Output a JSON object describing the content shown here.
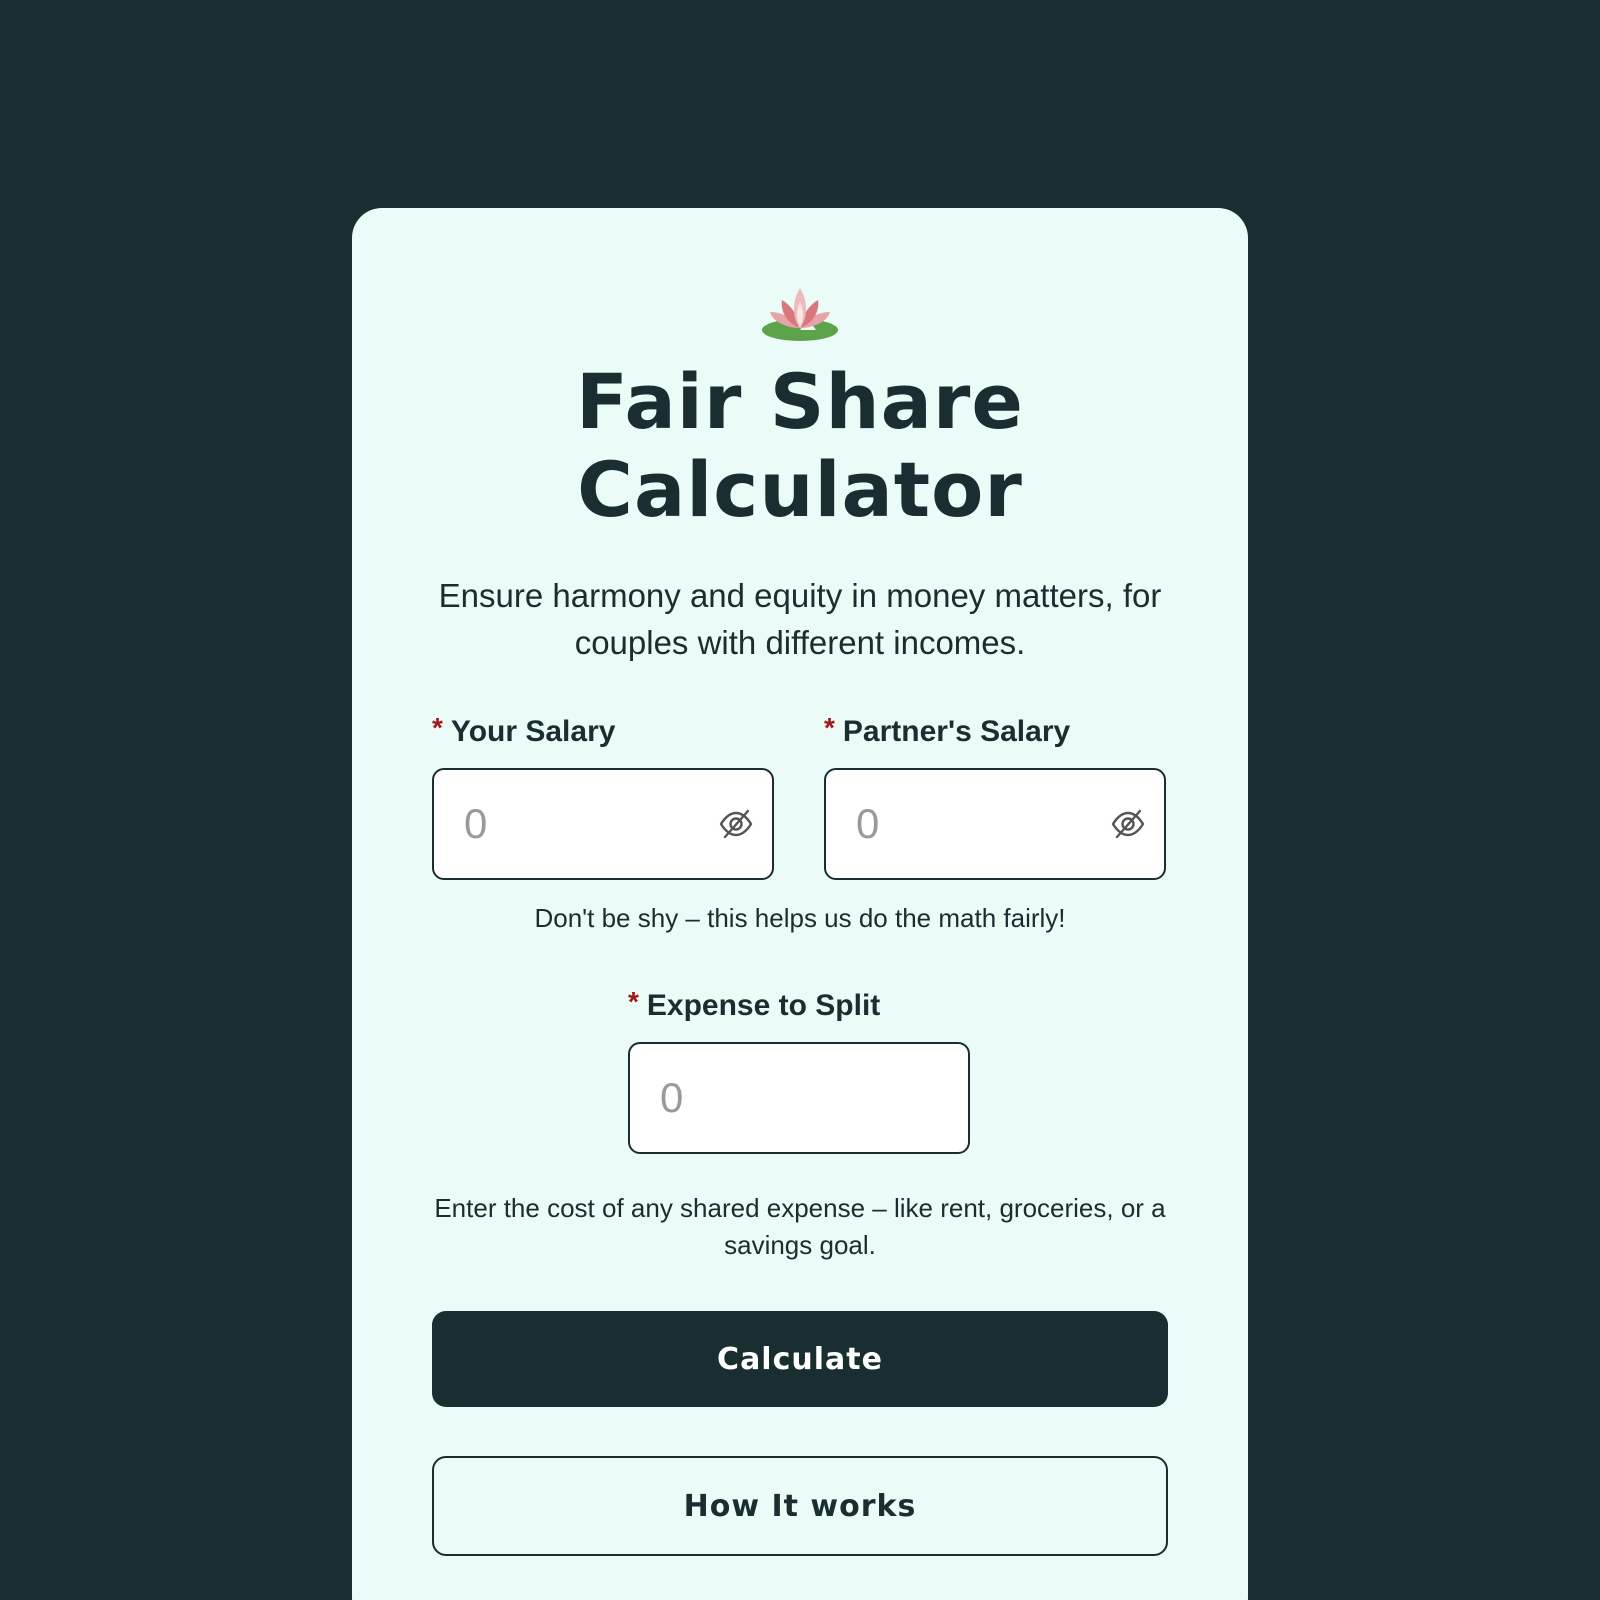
{
  "header": {
    "logo_icon": "lotus-icon",
    "title_line1": "Fair Share",
    "title_line2": "Calculator",
    "subtitle": "Ensure harmony and equity in money matters, for couples with different incomes."
  },
  "form": {
    "required_marker": "*",
    "your_salary": {
      "label": "Your Salary",
      "placeholder": "0",
      "value": "",
      "toggle_icon": "eye-off-icon"
    },
    "partner_salary": {
      "label": "Partner's Salary",
      "placeholder": "0",
      "value": "",
      "toggle_icon": "eye-off-icon"
    },
    "salary_hint": "Don't be shy – this helps us do the math fairly!",
    "expense": {
      "label": "Expense to Split",
      "placeholder": "0",
      "value": ""
    },
    "expense_hint": "Enter the cost of any shared expense – like rent, groceries, or a savings goal."
  },
  "actions": {
    "calculate_label": "Calculate",
    "how_it_works_label": "How It works"
  },
  "colors": {
    "background": "#1a2d30",
    "card": "#ebfbf7",
    "primary": "#1a2d30",
    "required": "#a01818"
  }
}
